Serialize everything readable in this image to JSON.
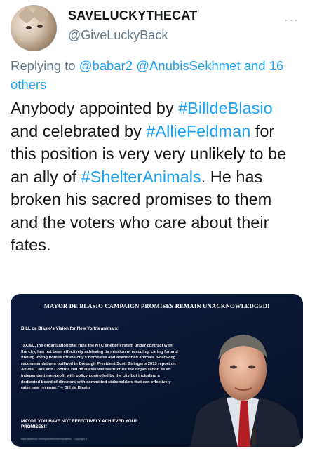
{
  "user": {
    "display_name": "SAVELUCKYTHECAT",
    "handle": "@GiveLuckyBack"
  },
  "reply": {
    "prefix": "Replying to ",
    "mentions": [
      "@babar2",
      "@AnubisSekhmet"
    ],
    "joiner": " ",
    "and_others": "and 16 others"
  },
  "tweet": {
    "seg1": "Anybody appointed by ",
    "tag1": "#BilldeBlasio",
    "seg2": " and celebrated by ",
    "tag2": "#AllieFeldman",
    "seg3": " for this position is very very unlikely to be an ally of ",
    "tag3": "#ShelterAnimals",
    "seg4": ".  He has broken his sacred promises to them and the voters who care about their fates."
  },
  "media": {
    "title": "MAYOR DE BLASIO CAMPAIGN PROMISES REMAIN UNACKNOWLEDGED!",
    "subtitle": "BILL de Blasio's Vision for New York's animals:",
    "quote": "\"AC&C, the organization that runs the NYC shelter system under contract with the city, has not been effectively achieving its mission of rescuing, caring for and finding loving homes for the city's homeless and abandoned animals. Following recommendations outlined in Borough President Scott Stringer's 2013 report on Animal Care and Control, Bill de Blasio will restructure the organization as an independent non-profit with policy controlled by the city but including a dedicated board of directors with committed stakeholders that can effectively raise new revenue.\" -- Bill de Blasio",
    "closing": "MAYOR YOU HAVE  NOT EFFECTIVELY ACHIEVED YOUR PROMISES!!",
    "footer": "www.facebook.com/nycshelterreformcoalition -- copyright ©"
  },
  "icons": {
    "more": "more-options-icon"
  },
  "colors": {
    "link": "#1da1f2",
    "secondary_text": "#657786",
    "primary_text": "#14171a",
    "media_bg": "#0a1733"
  }
}
